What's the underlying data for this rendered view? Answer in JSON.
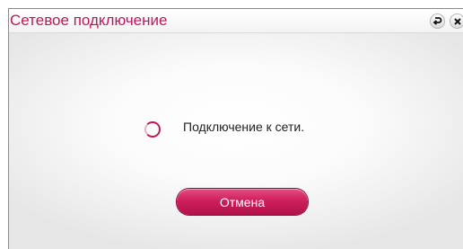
{
  "dialog": {
    "title": "Сетевое подключение",
    "status_text": "Подключение к сети.",
    "cancel_label": "Отмена"
  },
  "icons": {
    "back": "back-icon",
    "close": "close-icon",
    "spinner": "loading-spinner-icon"
  },
  "colors": {
    "accent": "#c0155a",
    "button": "#cf1f5f"
  }
}
